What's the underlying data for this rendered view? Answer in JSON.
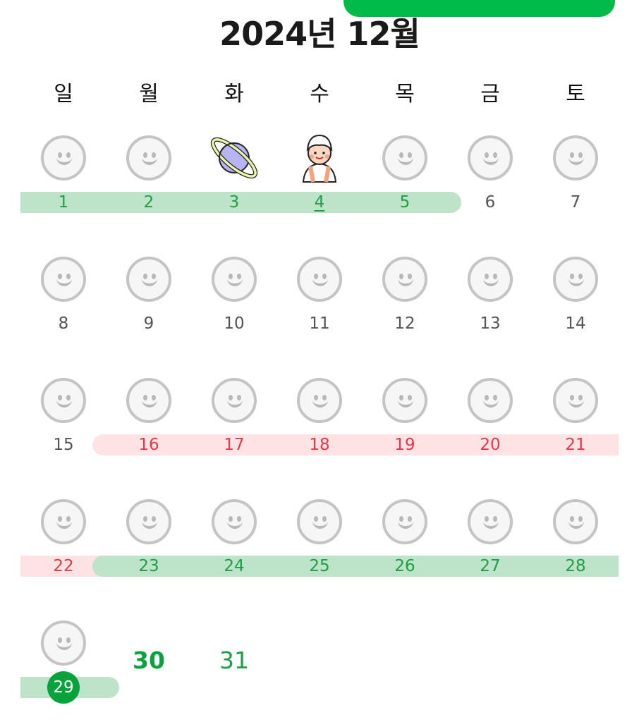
{
  "header": {
    "title": "2024년 12월"
  },
  "weekdays": [
    "일",
    "월",
    "화",
    "수",
    "목",
    "금",
    "토"
  ],
  "days": {
    "d1": "1",
    "d2": "2",
    "d3": "3",
    "d4": "4",
    "d5": "5",
    "d6": "6",
    "d7": "7",
    "d8": "8",
    "d9": "9",
    "d10": "10",
    "d11": "11",
    "d12": "12",
    "d13": "13",
    "d14": "14",
    "d15": "15",
    "d16": "16",
    "d17": "17",
    "d18": "18",
    "d19": "19",
    "d20": "20",
    "d21": "21",
    "d22": "22",
    "d23": "23",
    "d24": "24",
    "d25": "25",
    "d26": "26",
    "d27": "27",
    "d28": "28",
    "d29": "29",
    "d30": "30",
    "d31": "31"
  },
  "stickers": {
    "3": "planet-icon",
    "4": "character-icon",
    "default": "smiley-face-icon"
  },
  "colors": {
    "accent": "#00ba4a",
    "period_green": "#bde3c8",
    "period_pink": "#ffe2e4",
    "today": "#07a23c"
  }
}
